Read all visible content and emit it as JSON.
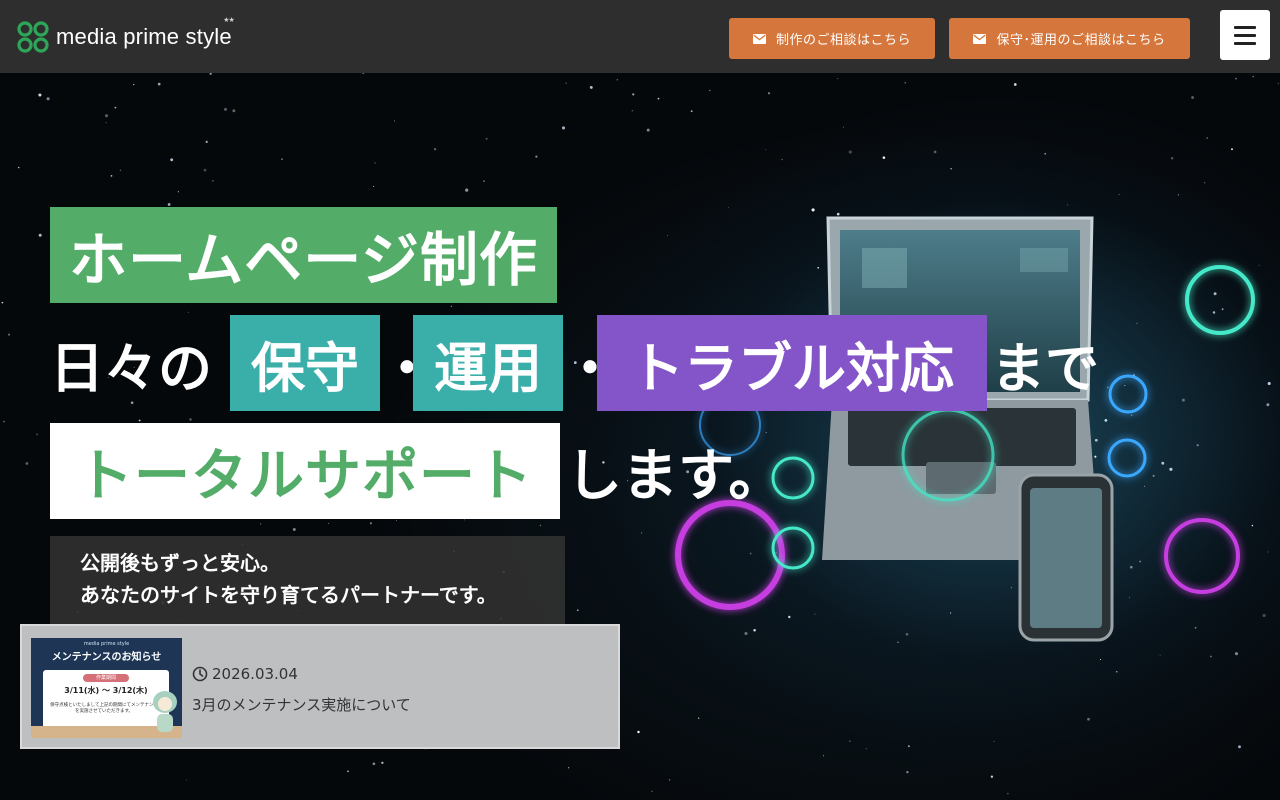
{
  "header": {
    "logo_text": "media prime style",
    "logo_stars": "★★",
    "cta_production": "制作のご相談はこちら",
    "cta_maintenance": "保守･運用のご相談はこちら",
    "menu_icon": "hamburger-icon"
  },
  "hero": {
    "headline_1": "ホームページ制作",
    "headline_2": {
      "prefix": "日々の",
      "hl_a": "保守",
      "sep_1": "・",
      "hl_b": "運用",
      "sep_2": "・",
      "hl_c": "トラブル対応",
      "suffix": "まで"
    },
    "headline_3": {
      "hl": "トータルサポート",
      "suffix": "します。"
    },
    "subcopy_1": "公開後もずっと安心。",
    "subcopy_2": "あなたのサイトを守り育てるパートナーです。"
  },
  "news": {
    "date": "2026.03.04",
    "title": "3月のメンテナンス実施について",
    "thumbnail": {
      "brand": "media prime style",
      "heading": "メンテナンスのお知らせ",
      "tag": "作業期間",
      "period": "3/11(水) ～ 3/12(木)",
      "note": "保守点検といたしまして上記の期間にてメンテナンスを実施させていただきます。"
    }
  },
  "colors": {
    "header_bg": "#2e2e2e",
    "cta_orange": "#d5773d",
    "green": "#53ac67",
    "teal": "#3aaea9",
    "purple": "#8455c9"
  }
}
